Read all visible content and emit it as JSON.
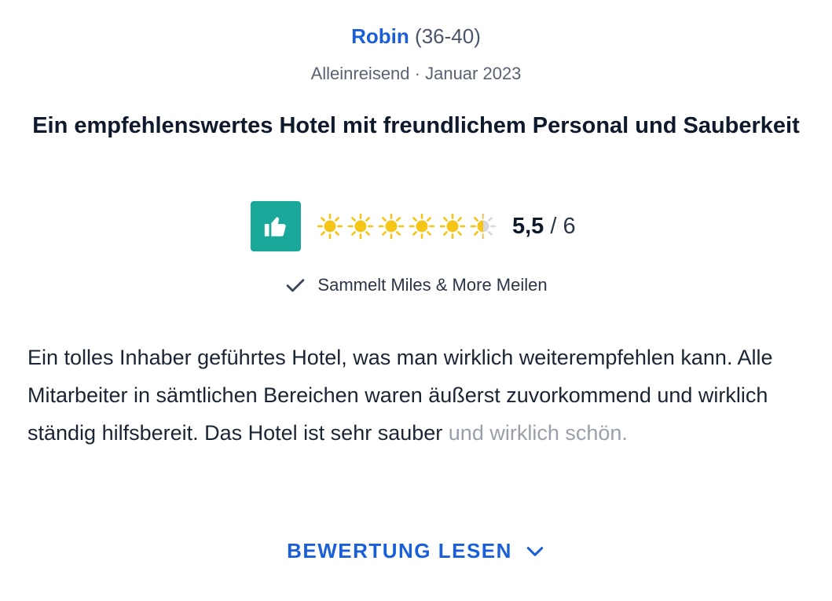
{
  "reviewer": {
    "name": "Robin",
    "age_range": "(36-40)"
  },
  "meta": {
    "travel_type": "Alleinreisend",
    "separator": " · ",
    "date": "Januar 2023"
  },
  "review": {
    "title": "Ein empfehlenswertes Hotel mit freundlichem Personal und Sauberkeit",
    "rating": {
      "value": "5,5",
      "separator": " / ",
      "max": "6",
      "suns_full": 5,
      "suns_half": 1,
      "icon": "thumbs-up-icon"
    },
    "miles_note": "Sammelt Miles & More Meilen",
    "text_main": "Ein tolles Inhaber geführtes Hotel, was man wirklich weiterempfehlen kann. Alle Mitarbeiter in sämtlichen Bereichen waren äußerst zuvorkommend und wirklich ständig hilfsbereit. Das Hotel ist sehr sauber",
    "text_faded": "und wirklich schön."
  },
  "read_more": {
    "label": "BEWERTUNG LESEN",
    "icon": "chevron-down-icon"
  },
  "colors": {
    "link_blue": "#1a5fd8",
    "thumb_green": "#1aa89b",
    "sun_yellow": "#f5c518",
    "text_dark": "#0e1a2b"
  }
}
